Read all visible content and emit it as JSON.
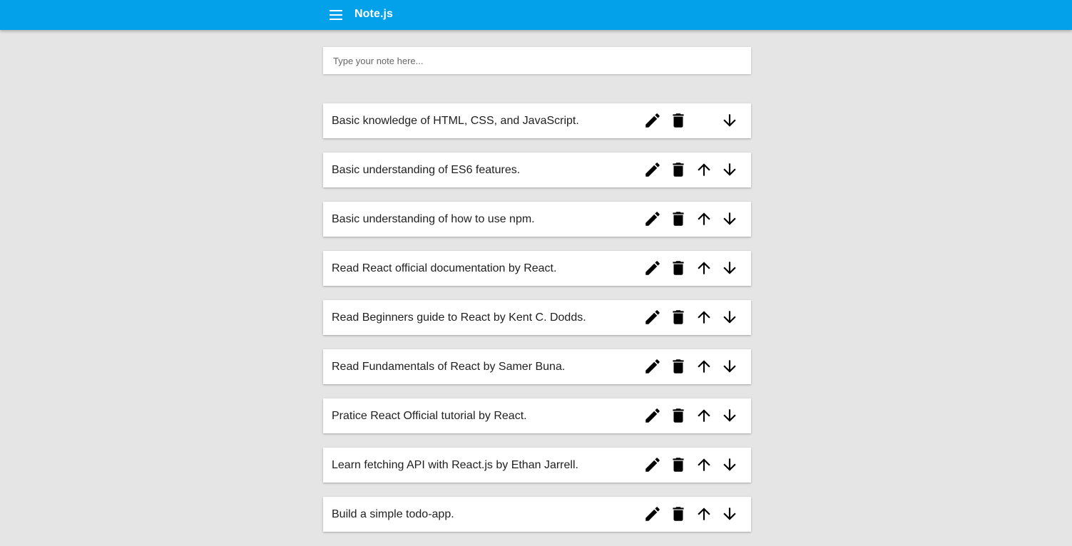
{
  "app": {
    "title": "Note.js",
    "bar_color": "#03a1e9",
    "menu_icon": "menu-icon"
  },
  "input": {
    "placeholder": "Type your note here...",
    "value": ""
  },
  "notes": [
    {
      "text": "Basic knowledge of HTML, CSS, and JavaScript.",
      "can_move_up": false,
      "can_move_down": true
    },
    {
      "text": "Basic understanding of ES6 features.",
      "can_move_up": true,
      "can_move_down": true
    },
    {
      "text": "Basic understanding of how to use npm.",
      "can_move_up": true,
      "can_move_down": true
    },
    {
      "text": "Read React official documentation by React.",
      "can_move_up": true,
      "can_move_down": true
    },
    {
      "text": "Read Beginners guide to React by Kent C. Dodds.",
      "can_move_up": true,
      "can_move_down": true
    },
    {
      "text": "Read Fundamentals of React by Samer Buna.",
      "can_move_up": true,
      "can_move_down": true
    },
    {
      "text": "Pratice React Official tutorial by React.",
      "can_move_up": true,
      "can_move_down": true
    },
    {
      "text": "Learn fetching API with React.js by Ethan Jarrell.",
      "can_move_up": true,
      "can_move_down": true
    },
    {
      "text": "Build a simple todo-app.",
      "can_move_up": true,
      "can_move_down": true
    }
  ],
  "note_actions": {
    "edit_icon": "pencil-icon",
    "delete_icon": "trash-icon",
    "up_icon": "arrow-up-icon",
    "down_icon": "arrow-down-icon"
  }
}
